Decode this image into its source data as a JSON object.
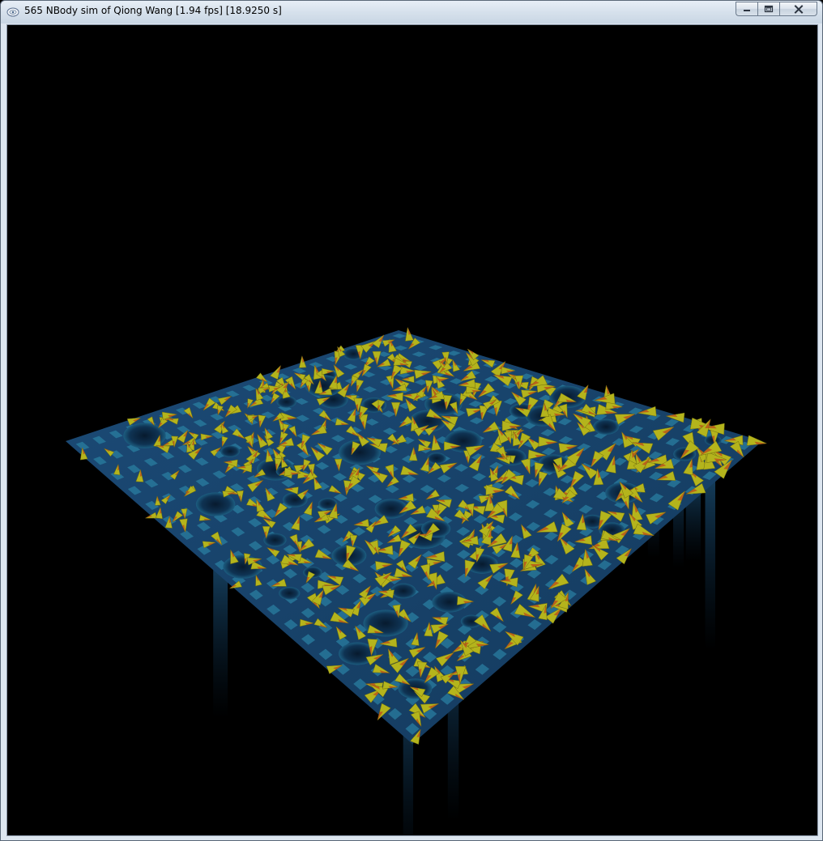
{
  "window": {
    "title": "565 NBody sim of Qiong Wang [1.94 fps] [18.9250 s]",
    "icon": "opengl-window-icon",
    "buttons": {
      "minimize": "minimize-icon",
      "maximize": "maximize-icon",
      "close": "close-icon"
    }
  },
  "scene": {
    "background_color": "#000000",
    "floor_color": "#163e63",
    "tile_color": "#2a7ea0",
    "particle_color": "#b4b41c",
    "particle_tip_color": "#c0201a",
    "particle_count_label": "565"
  }
}
